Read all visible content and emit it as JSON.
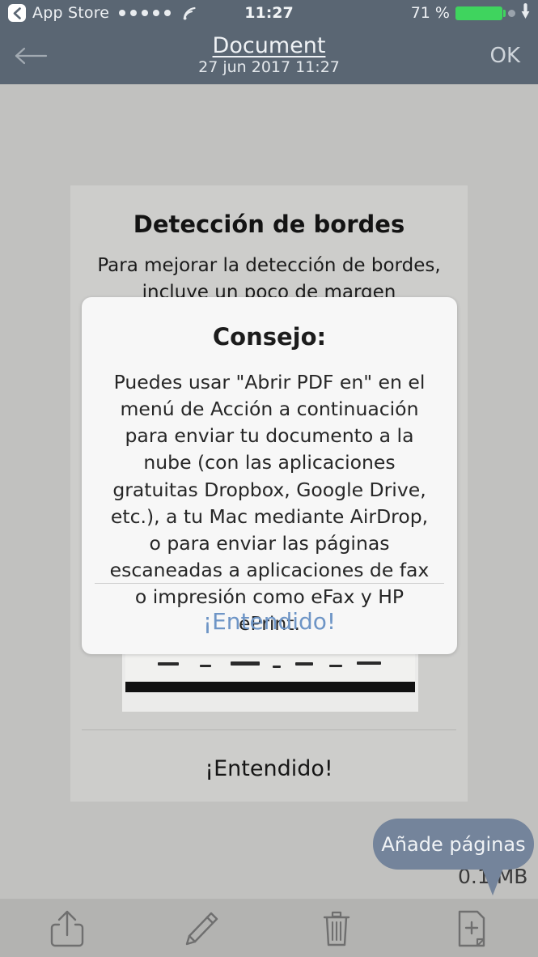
{
  "status_bar": {
    "back_label": "App Store",
    "back_icon": "chevron-left-icon",
    "signal_icon": "signal-dots-icon",
    "signal_dots": 5,
    "carrier_icon": "wifi-icon",
    "time": "11:27",
    "battery_percent": "71 %",
    "battery_fill_color": "#3fd45e",
    "extra_dot_icon": "status-dot-icon",
    "location_icon": "location-arrow-icon"
  },
  "nav_bar": {
    "back_icon": "arrow-left-icon",
    "title": "Document",
    "subtitle": "27 jun 2017 11:27",
    "done_label": "OK",
    "background_color": "#5a6673"
  },
  "card": {
    "title": "Detección de bordes",
    "description": "Para mejorar la detección de bordes, incluye un poco de margen",
    "scan_preview_name": "scanned-document-preview",
    "cta_label": "¡Entendido!",
    "background_color": "#cdcdcb"
  },
  "dialog": {
    "title": "Consejo:",
    "body": "Puedes usar \"Abrir PDF en\" en el menú de Acción a continuación para enviar tu documento a la nube (con las aplicaciones gratuitas Dropbox, Google Drive, etc.), a tu Mac mediante AirDrop, o para enviar las páginas escaneadas a aplicaciones de fax o impresión como eFax y HP ePrint.",
    "action_label": "¡Entendido!",
    "action_color": "#6e95c6",
    "background_color": "#f7f7f7"
  },
  "tooltip": {
    "label": "Añade páginas",
    "background_color": "#74849b"
  },
  "document_info": {
    "file_size": "0.1 MB"
  },
  "toolbar": {
    "background_color": "#b3b3b1",
    "items": [
      {
        "name": "share-icon",
        "label": "Compartir"
      },
      {
        "name": "edit-pencil-icon",
        "label": "Editar"
      },
      {
        "name": "trash-icon",
        "label": "Eliminar"
      },
      {
        "name": "add-page-icon",
        "label": "Añadir página"
      }
    ]
  }
}
